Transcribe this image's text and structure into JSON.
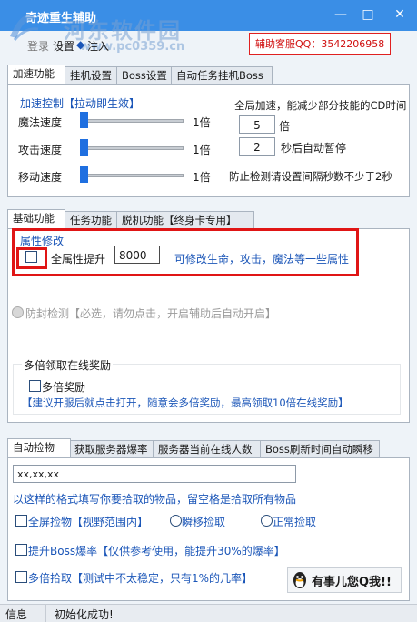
{
  "window": {
    "title": "奇迹重生辅助",
    "watermark": "河东软件园",
    "watermark_url": "www.pc0359.cn",
    "minimize_glyph": "—",
    "maximize_glyph": "□",
    "close_glyph": "✕"
  },
  "menu": {
    "login": "登录",
    "settings": "设置",
    "inject": "注入",
    "diamond": "◆"
  },
  "service": {
    "text": "辅助客服QQ：3542206958"
  },
  "top_tabs": [
    "加速功能",
    "挂机设置",
    "Boss设置",
    "自动任务挂机Boss"
  ],
  "speed": {
    "group_title": "加速控制【拉动即生效】",
    "rows": [
      {
        "label": "魔法速度",
        "value": "1倍",
        "level": 0.0
      },
      {
        "label": "攻击速度",
        "value": "1倍",
        "level": 0.0
      },
      {
        "label": "移动速度",
        "value": "1倍",
        "level": 0.0
      }
    ],
    "global_title": "全局加速，能减少部分技能的CD时间",
    "multiplier_value": "5",
    "multiplier_unit": "倍",
    "pause_value": "2",
    "pause_unit": "秒后自动暂停",
    "warning": "防止检测请设置间隔秒数不少于2秒"
  },
  "mid_tabs": [
    "基础功能",
    "任务功能",
    "脱机功能【终身卡专用】"
  ],
  "attr": {
    "group_title": "属性修改",
    "checkbox_label": "全属性提升",
    "value": "8000",
    "hint": "可修改生命，攻击，魔法等一些属性"
  },
  "anti": {
    "label": "防封检测【必选，请勿点击，开启辅助后自动开启】"
  },
  "reward": {
    "group_title": "多倍领取在线奖励",
    "checkbox_label": "多倍奖励",
    "note": "【建议开服后就点击打开，随意会多倍奖励，最高领取10倍在线奖励】"
  },
  "bottom_tabs": [
    "自动捡物",
    "获取服务器爆率",
    "服务器当前在线人数",
    "Boss刷新时间自动瞬移"
  ],
  "pickup": {
    "input_value": "xx,xx,xx",
    "hint": "以这样的格式填写你要拾取的物品，留空格是拾取所有物品",
    "fullscreen_label": "全屏捡物【视野范围内】",
    "teleport_label": "瞬移捡取",
    "normal_label": "正常捡取",
    "boss_label": "提升Boss爆率【仅供参考使用，能提升30%的爆率】",
    "multi_label": "多倍拾取【测试中不太稳定，只有1%的几率】",
    "qq_label": "有事儿您Q我!!"
  },
  "status": {
    "label": "信息",
    "message": "初始化成功!"
  },
  "colors": {
    "titlebar": "#3a8ee6",
    "accent_blue": "#1b56b8",
    "highlight_red": "#e01515"
  }
}
